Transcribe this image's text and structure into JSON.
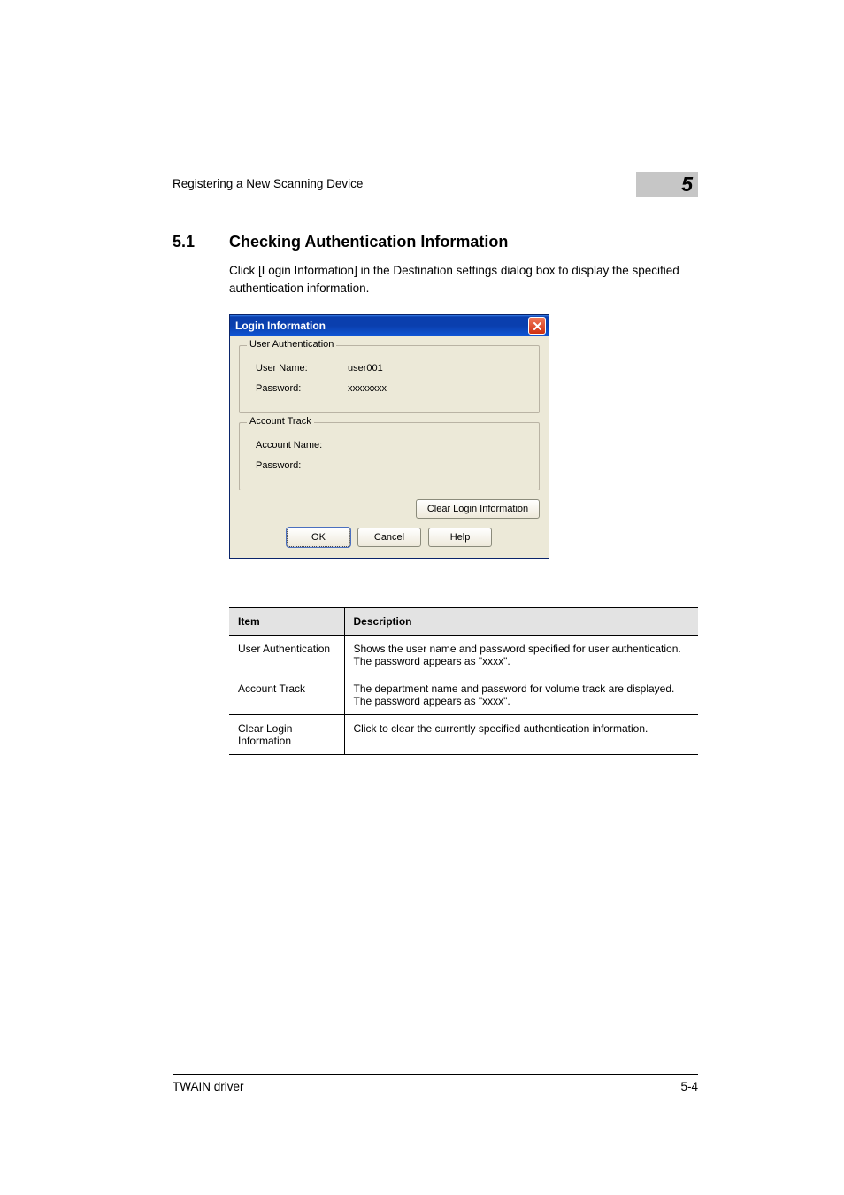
{
  "header": {
    "breadcrumb": "Registering a New Scanning Device",
    "chapter_number": "5"
  },
  "section": {
    "number": "5.1",
    "title": "Checking Authentication Information",
    "paragraph": "Click [Login Information] in the Destination settings dialog box to display the specified authentication information."
  },
  "dialog": {
    "title": "Login Information",
    "groups": {
      "user_auth": {
        "legend": "User Authentication",
        "user_label": "User Name:",
        "user_value": "user001",
        "pass_label": "Password:",
        "pass_value": "xxxxxxxx"
      },
      "account_track": {
        "legend": "Account Track",
        "acct_label": "Account Name:",
        "acct_value": "",
        "pass_label": "Password:",
        "pass_value": ""
      }
    },
    "buttons": {
      "clear": "Clear Login Information",
      "ok": "OK",
      "cancel": "Cancel",
      "help": "Help"
    }
  },
  "table": {
    "head_item": "Item",
    "head_desc": "Description",
    "rows": [
      {
        "item": "User Authentication",
        "desc": "Shows the user name and password specified for user authentication. The password appears as \"xxxx\"."
      },
      {
        "item": "Account Track",
        "desc": "The department name and password for volume track are displayed. The password appears as \"xxxx\"."
      },
      {
        "item": "Clear Login Information",
        "desc": "Click to clear the currently specified authentication information."
      }
    ]
  },
  "footer": {
    "product": "TWAIN driver",
    "page": "5-4"
  }
}
